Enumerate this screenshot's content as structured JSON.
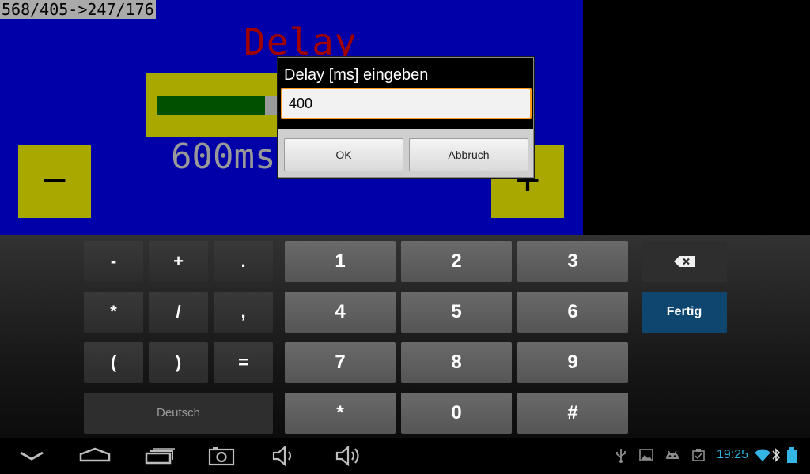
{
  "app": {
    "coord_readout": "568/405->247/176",
    "title": "Delay",
    "value_text": "600ms",
    "minus_label": "−",
    "plus_label": "+",
    "slider": {
      "value_fraction": 0.4
    }
  },
  "dialog": {
    "title": "Delay [ms] eingeben",
    "input_value": "400",
    "ok_label": "OK",
    "cancel_label": "Abbruch"
  },
  "keyboard": {
    "sym_row1": [
      "-",
      "+",
      "."
    ],
    "sym_row2": [
      "*",
      "/",
      ","
    ],
    "sym_row3": [
      "(",
      ")",
      "="
    ],
    "num_row1": [
      "1",
      "2",
      "3"
    ],
    "num_row2": [
      "4",
      "5",
      "6"
    ],
    "num_row3": [
      "7",
      "8",
      "9"
    ],
    "num_row4": [
      "*",
      "0",
      "#"
    ],
    "language_label": "Deutsch",
    "done_label": "Fertig",
    "backspace_icon": "backspace-icon"
  },
  "navbar": {
    "buttons": [
      "hide-keyboard-icon",
      "home-icon",
      "recent-apps-icon",
      "screenshot-icon",
      "volume-down-icon",
      "volume-up-icon"
    ],
    "status_icons": [
      "usb-icon",
      "image-icon",
      "android-icon",
      "clipboard-icon",
      "wifi-icon",
      "bluetooth-icon",
      "battery-icon"
    ],
    "clock": "19:25",
    "accent_color": "#33b5e5"
  }
}
